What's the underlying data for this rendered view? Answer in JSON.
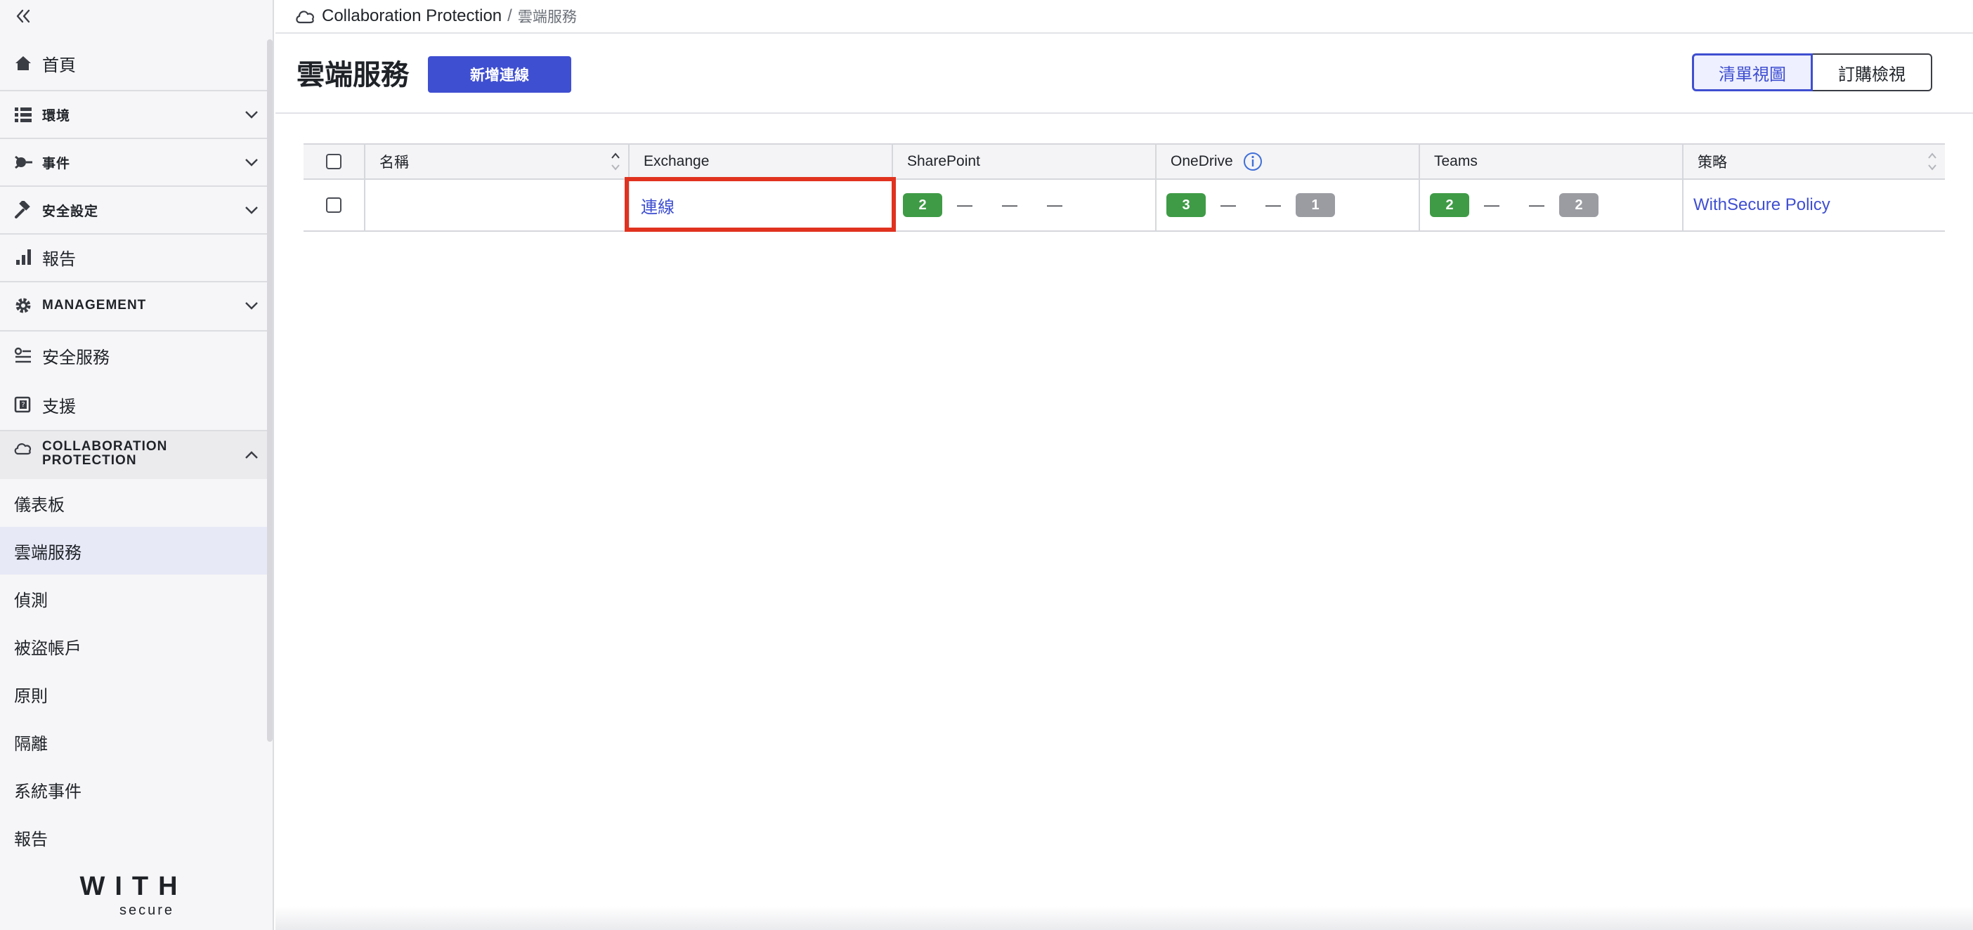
{
  "sidebar": {
    "home": "首頁",
    "environment": "環境",
    "incidents": "事件",
    "security_settings": "安全設定",
    "reports": "報告",
    "management": "MANAGEMENT",
    "security_services": "安全服務",
    "support": "支援",
    "collab_line1": "COLLABORATION",
    "collab_line2": "PROTECTION",
    "sub_items": [
      "儀表板",
      "雲端服務",
      "偵測",
      "被盜帳戶",
      "原則",
      "隔離",
      "系統事件",
      "報告"
    ],
    "active_sub_item": "雲端服務",
    "logo_text": "WITH",
    "logo_sub": "secure"
  },
  "breadcrumb": {
    "root": "Collaboration Protection",
    "separator": "/",
    "current": "雲端服務"
  },
  "header": {
    "title": "雲端服務",
    "add_button": "新增連線",
    "view_list": "清單視圖",
    "view_subscription": "訂購檢視"
  },
  "table": {
    "columns": [
      "名稱",
      "Exchange",
      "SharePoint",
      "OneDrive",
      "Teams",
      "策略"
    ],
    "rows": [
      {
        "name": "",
        "exchange": "連線",
        "sharepoint": {
          "badge": "2",
          "dashes": [
            "—",
            "—",
            "—"
          ]
        },
        "onedrive": {
          "badge": "3",
          "dashes": [
            "—",
            "—"
          ],
          "gray_badge": "1"
        },
        "teams": {
          "badge": "2",
          "dashes": [
            "—",
            "—"
          ],
          "gray_badge": "2"
        },
        "policy": "WithSecure Policy"
      }
    ]
  },
  "colors": {
    "accent": "#3f4fd1",
    "success": "#3f9b46",
    "neutral_badge": "#9a9ca2",
    "highlight": "#e0321f"
  }
}
